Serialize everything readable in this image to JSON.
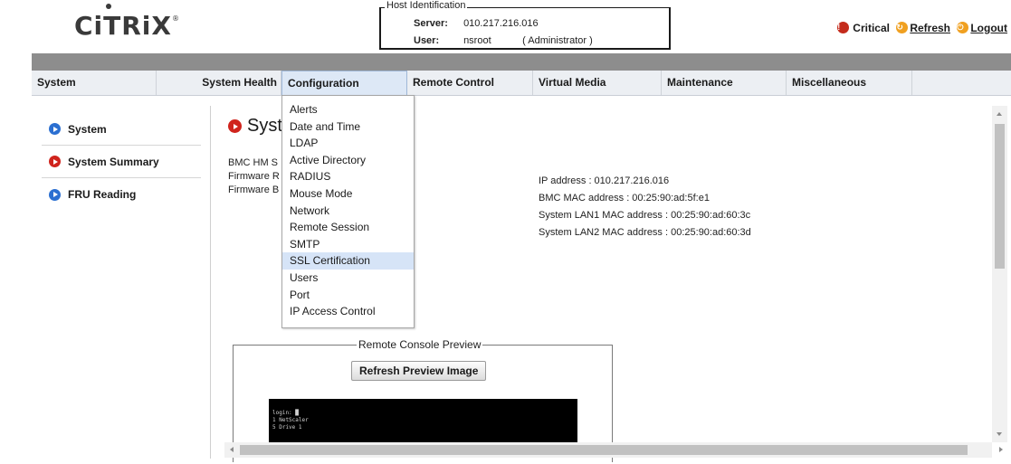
{
  "brand": {
    "logo_text": "CiTRiX",
    "registered_mark": "®"
  },
  "host": {
    "legend": "Host Identification",
    "server_label": "Server:",
    "server_value": "010.217.216.016",
    "user_label": "User:",
    "user_value": "nsroot",
    "role": "( Administrator )"
  },
  "toplinks": {
    "critical": "Critical",
    "refresh": "Refresh",
    "logout": "Logout"
  },
  "nav": {
    "tabs": [
      {
        "label": "System"
      },
      {
        "label": "System Health"
      },
      {
        "label": "Configuration"
      },
      {
        "label": "Remote Control"
      },
      {
        "label": "Virtual Media"
      },
      {
        "label": "Maintenance"
      },
      {
        "label": "Miscellaneous"
      }
    ]
  },
  "sidebar": {
    "items": [
      {
        "label": "System"
      },
      {
        "label": "System Summary"
      },
      {
        "label": "FRU Reading"
      }
    ]
  },
  "content": {
    "title": "Syst",
    "labels": [
      "BMC HM S",
      "Firmware R",
      "Firmware B"
    ],
    "network": {
      "ip": "IP address : 010.217.216.016",
      "bmc_mac": "BMC MAC address : 00:25:90:ad:5f:e1",
      "lan1_mac": "System LAN1 MAC address : 00:25:90:ad:60:3c",
      "lan2_mac": "System LAN2 MAC address : 00:25:90:ad:60:3d"
    }
  },
  "config_menu": {
    "items": [
      {
        "label": "Alerts"
      },
      {
        "label": "Date and Time"
      },
      {
        "label": "LDAP"
      },
      {
        "label": "Active Directory"
      },
      {
        "label": "RADIUS"
      },
      {
        "label": "Mouse Mode"
      },
      {
        "label": "Network"
      },
      {
        "label": "Remote Session"
      },
      {
        "label": "SMTP"
      },
      {
        "label": "SSL Certification"
      },
      {
        "label": "Users"
      },
      {
        "label": "Port"
      },
      {
        "label": "IP Access Control"
      }
    ],
    "highlighted": "SSL Certification"
  },
  "preview": {
    "legend": "Remote Console Preview",
    "refresh_button": "Refresh Preview Image",
    "console_lines": [
      "login: █",
      "1  NetScaler",
      "5  Drive 1"
    ]
  },
  "colors": {
    "nav_bg": "#eceff3",
    "band": "#8d8d8d",
    "arrow_blue": "#2b6fd1",
    "arrow_red": "#d0241d",
    "menu_highlight": "#d6e4f7"
  }
}
